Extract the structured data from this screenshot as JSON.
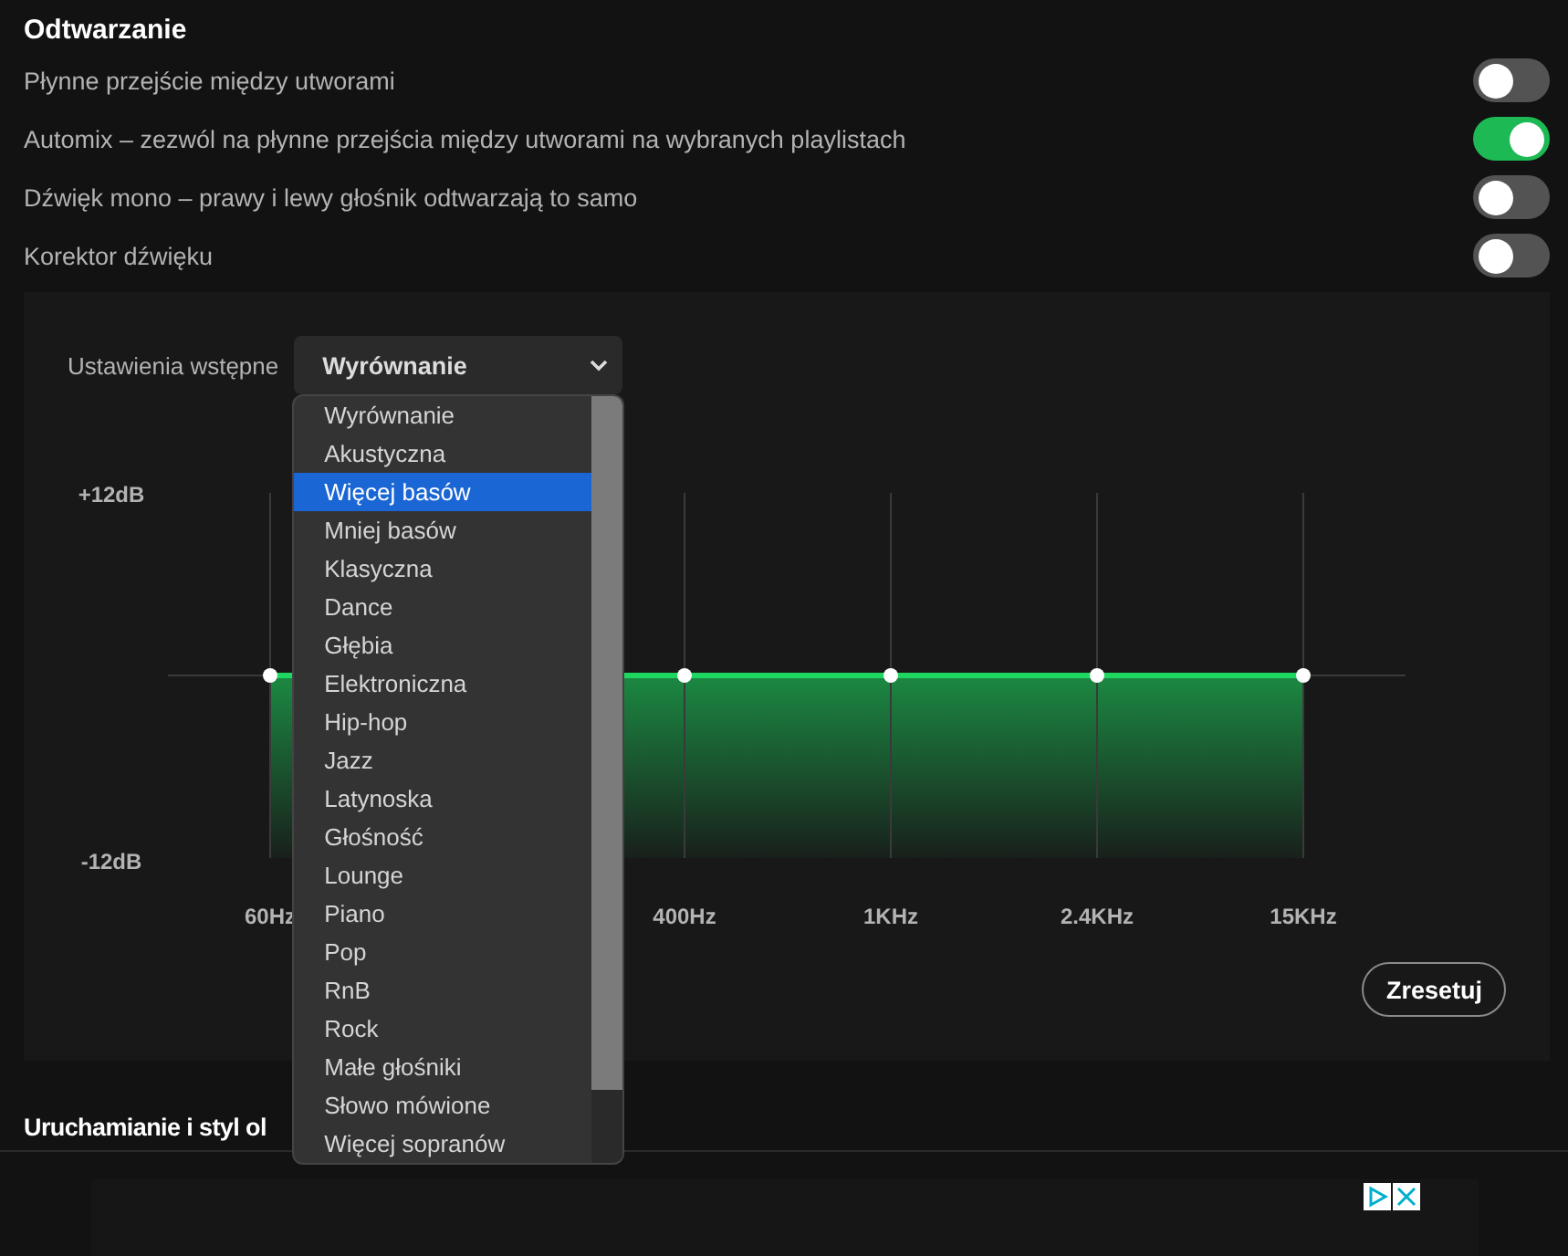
{
  "playback": {
    "title": "Odtwarzanie",
    "settings": [
      {
        "label": "Płynne przejście między utworami",
        "on": false
      },
      {
        "label": "Automix – zezwól na płynne przejścia między utworami na wybranych playlistach",
        "on": true
      },
      {
        "label": "Dźwięk mono – prawy i lewy głośnik odtwarzają to samo",
        "on": false
      },
      {
        "label": "Korektor dźwięku",
        "on": false
      }
    ]
  },
  "equalizer": {
    "preset_label": "Ustawienia wstępne",
    "preset_value": "Wyrównanie",
    "preset_options": [
      {
        "label": "Wyrównanie",
        "selected": false
      },
      {
        "label": "Akustyczna",
        "selected": false
      },
      {
        "label": "Więcej basów",
        "selected": true
      },
      {
        "label": "Mniej basów",
        "selected": false
      },
      {
        "label": "Klasyczna",
        "selected": false
      },
      {
        "label": "Dance",
        "selected": false
      },
      {
        "label": "Głębia",
        "selected": false
      },
      {
        "label": "Elektroniczna",
        "selected": false
      },
      {
        "label": "Hip-hop",
        "selected": false
      },
      {
        "label": "Jazz",
        "selected": false
      },
      {
        "label": "Latynoska",
        "selected": false
      },
      {
        "label": "Głośność",
        "selected": false
      },
      {
        "label": "Lounge",
        "selected": false
      },
      {
        "label": "Piano",
        "selected": false
      },
      {
        "label": "Pop",
        "selected": false
      },
      {
        "label": "RnB",
        "selected": false
      },
      {
        "label": "Rock",
        "selected": false
      },
      {
        "label": "Małe głośniki",
        "selected": false
      },
      {
        "label": "Słowo mówione",
        "selected": false
      },
      {
        "label": "Więcej sopranów",
        "selected": false
      }
    ],
    "y_top_label": "+12dB",
    "y_bottom_label": "-12dB",
    "bands": [
      {
        "label": "60Hz",
        "level": 0.5
      },
      {
        "label": "400Hz",
        "level": 0.5
      },
      {
        "label": "1KHz",
        "level": 0.5
      },
      {
        "label": "2.4KHz",
        "level": 0.5
      },
      {
        "label": "15KHz",
        "level": 0.5
      }
    ],
    "reset_button": "Zresetuj"
  },
  "next_section": {
    "title": "Uruchamianie i styl ol"
  }
}
